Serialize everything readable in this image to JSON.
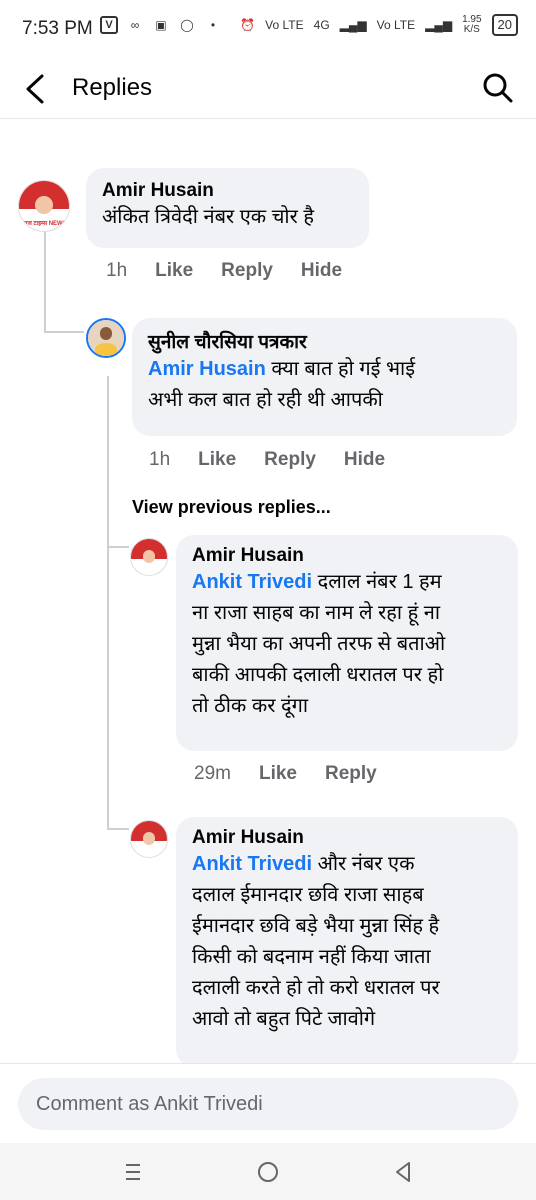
{
  "status": {
    "time": "7:53 PM",
    "battery": "20",
    "net_speed": "1.95",
    "net_unit": "K/S",
    "sim1": "Vo LTE",
    "sim2": "Vo LTE",
    "net_type": "4G"
  },
  "header": {
    "title": "Replies"
  },
  "comments": [
    {
      "author": "Amir Husain",
      "text": "अंकित त्रिवेदी नंबर एक चोर है",
      "time": "1h",
      "like": "Like",
      "reply": "Reply",
      "hide": "Hide"
    },
    {
      "author": "सुनील चौरसिया पत्रकार",
      "mention": "Amir Husain",
      "text_line1": " क्या बात हो गई भाई",
      "text_line2": "अभी कल बात हो रही थी आपकी",
      "time": "1h",
      "like": "Like",
      "reply": "Reply",
      "hide": "Hide"
    },
    {
      "author": "Amir Husain",
      "mention": "Ankit Trivedi",
      "text_line1": " दलाल नंबर 1 हम",
      "lines": [
        "ना राजा साहब का नाम ले रहा हूं ना",
        "मुन्ना भैया का अपनी तरफ से बताओ",
        "बाकी आपकी दलाली धरातल पर हो",
        "तो ठीक कर दूंगा"
      ],
      "time": "29m",
      "like": "Like",
      "reply": "Reply"
    },
    {
      "author": "Amir Husain",
      "mention": "Ankit Trivedi",
      "text_line1": " और नंबर एक",
      "lines": [
        "दलाल ईमानदार छवि राजा साहब",
        "ईमानदार छवि बड़े भैया मुन्ना सिंह है",
        "किसी को बदनाम नहीं किया जाता",
        "दलाली करते हो तो करो धरातल पर",
        "आवो तो बहुत पिटे जावोगे"
      ]
    }
  ],
  "view_previous": "View previous replies...",
  "composer": {
    "placeholder": "Comment as Ankit Trivedi"
  },
  "avatar_text": "आज टाइम्स NEWS"
}
